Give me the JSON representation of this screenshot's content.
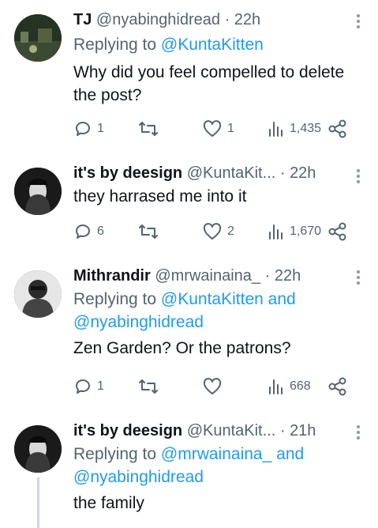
{
  "tweets": [
    {
      "name": "TJ",
      "handle": "@nyabinghidread",
      "dot": "·",
      "time": "22h",
      "reply_prefix": "Replying to",
      "reply_to": "@KuntaKitten",
      "reply_and": "",
      "reply_to2": "",
      "text": "Why did you feel compelled to delete the post?",
      "replies": "1",
      "retweets": "",
      "likes": "1",
      "views": "1,435"
    },
    {
      "name": "it's by deesign",
      "handle": "@KuntaKit...",
      "dot": "·",
      "time": "22h",
      "text": "they harrased me into it",
      "replies": "6",
      "retweets": "",
      "likes": "2",
      "views": "1,670"
    },
    {
      "name": "Mithrandir",
      "handle": "@mrwainaina_",
      "dot": "·",
      "time": "22h",
      "reply_prefix": "Replying to",
      "reply_to": "@KuntaKitten",
      "reply_and": "and",
      "reply_to2": "@nyabinghidread",
      "text": "Zen Garden? Or the patrons?",
      "replies": "1",
      "retweets": "",
      "likes": "",
      "views": "668"
    },
    {
      "name": "it's by deesign",
      "handle": "@KuntaKit...",
      "dot": "·",
      "time": "21h",
      "reply_prefix": "Replying to",
      "reply_to": "@mrwainaina_",
      "reply_and": "and",
      "reply_to2": "@nyabinghidread",
      "text": "the family"
    }
  ],
  "icons": {
    "reply": "reply-icon",
    "retweet": "retweet-icon",
    "like": "heart-icon",
    "views": "views-icon",
    "share": "share-icon",
    "more": "more-icon"
  },
  "colors": {
    "link": "#1d9bf0",
    "muted": "#536471",
    "text": "#0f1419"
  }
}
